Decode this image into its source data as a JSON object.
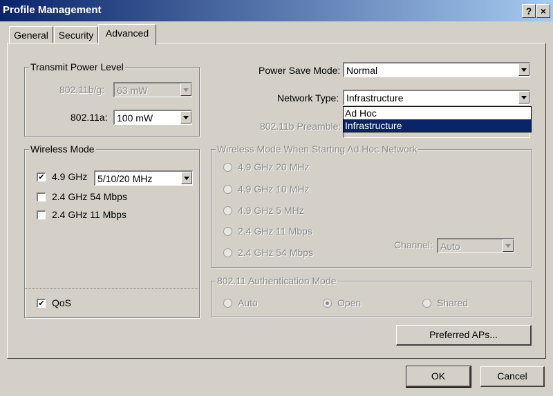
{
  "window": {
    "title": "Profile Management",
    "help": "?",
    "close": "×"
  },
  "tabs": [
    {
      "label": "General"
    },
    {
      "label": "Security"
    },
    {
      "label": "Advanced"
    }
  ],
  "transmit": {
    "legend": "Transmit Power Level",
    "bg_label": "802.11b/g:",
    "bg_value": "63 mW",
    "a_label": "802.11a:",
    "a_value": "100 mW"
  },
  "power_save": {
    "label": "Power Save Mode:",
    "value": "Normal"
  },
  "network_type": {
    "label": "Network Type:",
    "value": "Infrastructure",
    "options": [
      "Ad Hoc",
      "Infrastructure"
    ]
  },
  "preamble": {
    "label": "802.11b Preamble:"
  },
  "wireless_mode": {
    "legend": "Wireless Mode",
    "ghz49_label": "4.9 GHz",
    "ghz49_checked": true,
    "ghz49_bw": "5/10/20 MHz",
    "ghz24_54_label": "2.4 GHz 54 Mbps",
    "ghz24_54_checked": false,
    "ghz24_11_label": "2.4 GHz 11 Mbps",
    "ghz24_11_checked": false,
    "qos_label": "QoS",
    "qos_checked": true
  },
  "adhoc": {
    "legend": "Wireless Mode When Starting Ad Hoc Network",
    "options": [
      "4.9 GHz 20 MHz",
      "4.9 GHz 10 MHz",
      "4.9 GHz 5 MHz",
      "2.4 GHz 11 Mbps",
      "2.4 GHz 54 Mbps"
    ],
    "channel_label": "Channel:",
    "channel_value": "Auto"
  },
  "auth": {
    "legend": "802.11 Authentication Mode",
    "options": [
      "Auto",
      "Open",
      "Shared"
    ],
    "selected": "Open"
  },
  "buttons": {
    "preferred": "Preferred APs...",
    "ok": "OK",
    "cancel": "Cancel"
  },
  "check_mark": "✔"
}
